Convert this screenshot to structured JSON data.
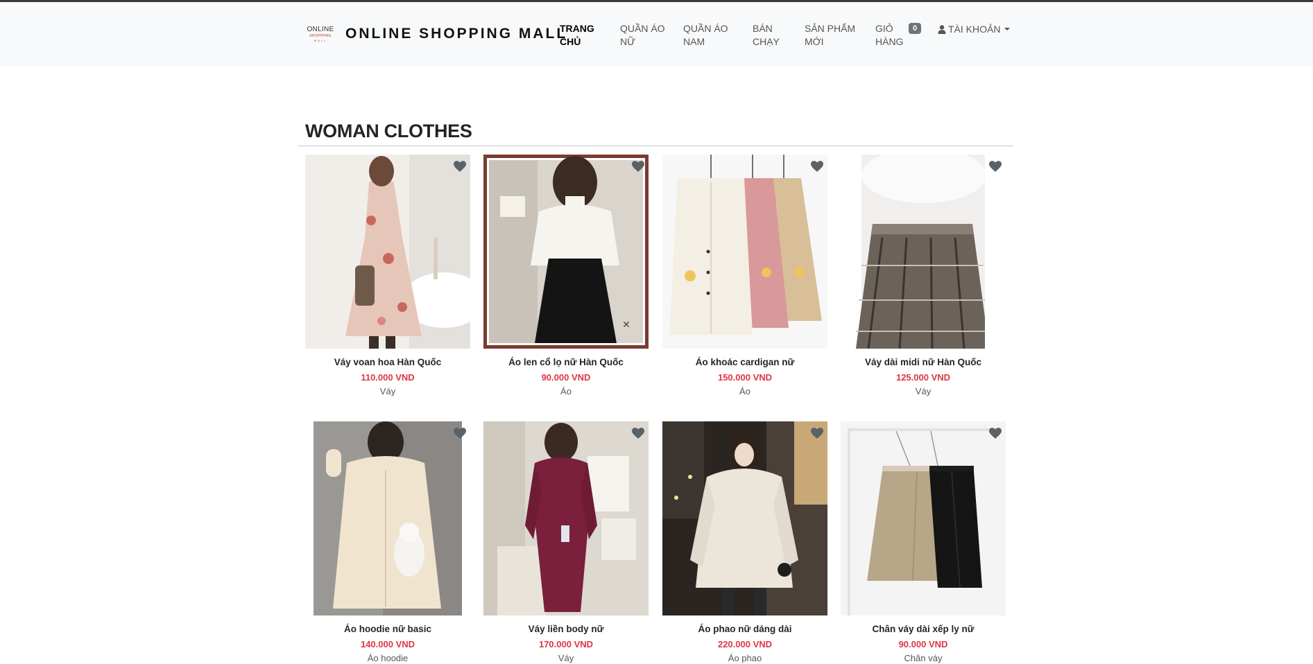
{
  "brand": {
    "logo_line1": "ONLINE",
    "logo_line2": "SHOPPPING",
    "logo_line3": "MALL",
    "name": "ONLINE SHOPPING MALL"
  },
  "nav": {
    "items": [
      {
        "line1": "TRANG",
        "line2": "CHỦ",
        "active": true
      },
      {
        "line1": "QUẦN ÁO",
        "line2": "NỮ",
        "active": false
      },
      {
        "line1": "QUẦN ÁO",
        "line2": "NAM",
        "active": false
      },
      {
        "line1": "BÁN",
        "line2": "CHẠY",
        "active": false
      },
      {
        "line1": "SẢN PHẨM",
        "line2": "MỚI",
        "active": false
      },
      {
        "line1": "GIỎ",
        "line2": "HÀNG",
        "active": false
      }
    ],
    "cart_count": "0",
    "account_label": "TÀI KHOẢN"
  },
  "section": {
    "title": "WOMAN CLOTHES"
  },
  "products": [
    {
      "name": "Váy voan hoa Hàn Quốc",
      "price": "110.000 VND",
      "category": "Váy"
    },
    {
      "name": "Áo len cổ lọ nữ Hàn Quốc",
      "price": "90.000 VND",
      "category": "Áo"
    },
    {
      "name": "Áo khoác cardigan nữ",
      "price": "150.000 VND",
      "category": "Áo"
    },
    {
      "name": "Váy dài midi nữ Hàn Quốc",
      "price": "125.000 VND",
      "category": "Váy"
    },
    {
      "name": "Áo hoodie nữ basic",
      "price": "140.000 VND",
      "category": "Áo hoodie"
    },
    {
      "name": "Váy liền body nữ",
      "price": "170.000 VND",
      "category": "Váy"
    },
    {
      "name": "Áo phao nữ dáng dài",
      "price": "220.000 VND",
      "category": "Áo phao"
    },
    {
      "name": "Chân váy dài xếp ly nữ",
      "price": "90.000 VND",
      "category": "Chân váy"
    }
  ],
  "colors": {
    "price": "#dc3545",
    "navbar_bg": "#f8f9fa",
    "badge_bg": "#6c757d",
    "heart": "#5a6268"
  },
  "icons": {
    "account": "user-icon",
    "favorite": "heart-icon"
  }
}
